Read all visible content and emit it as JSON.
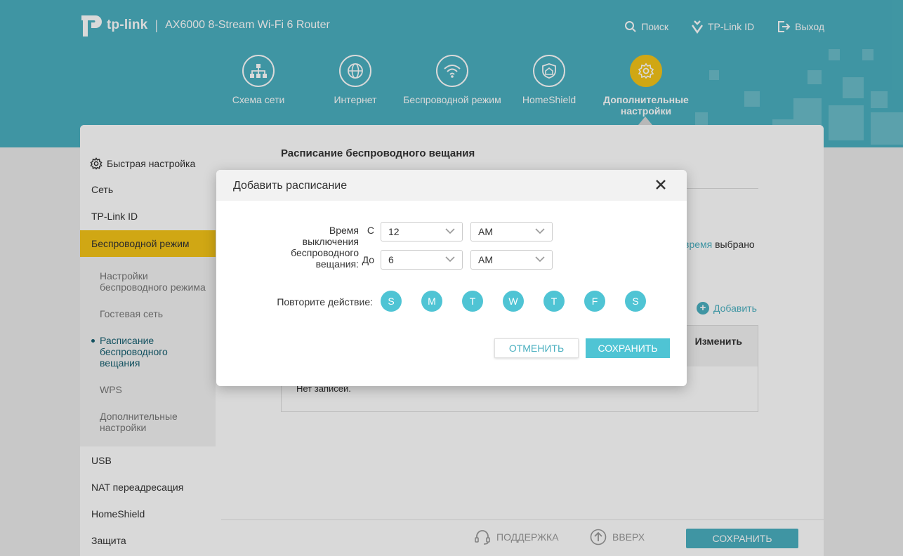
{
  "header": {
    "brand": "tp-link",
    "model": "AX6000 8-Stream Wi-Fi 6 Router",
    "links": [
      {
        "label": "Поиск",
        "icon": "search-icon"
      },
      {
        "label": "TP-Link ID",
        "icon": "tplink-id-icon"
      },
      {
        "label": "Выход",
        "icon": "logout-icon"
      }
    ]
  },
  "nav": {
    "items": [
      {
        "label": "Схема сети",
        "icon": "network-map-icon"
      },
      {
        "label": "Интернет",
        "icon": "globe-icon"
      },
      {
        "label": "Беспроводной режим",
        "icon": "wifi-icon"
      },
      {
        "label": "HomeShield",
        "icon": "home-shield-icon"
      },
      {
        "label": "Дополнительные настройки",
        "icon": "gear-icon",
        "active": true
      }
    ]
  },
  "sidebar": {
    "quick_setup": "Быстрая настройка",
    "items": [
      "Сеть",
      "TP-Link ID",
      "Беспроводной режим"
    ],
    "sub_items": [
      "Настройки беспроводного режима",
      "Гостевая сеть",
      "Расписание беспроводного вещания",
      "WPS",
      "Дополнительные настройки"
    ],
    "items_after": [
      "USB",
      "NAT переадресация",
      "HomeShield",
      "Защита"
    ]
  },
  "content": {
    "title": "Расписание беспроводного вещания",
    "desc_link": "время",
    "desc_text": " выбрано",
    "add_label": "Добавить",
    "column_edit": "Изменить",
    "empty_text": "Нет записей."
  },
  "footer": {
    "support": "ПОДДЕРЖКА",
    "up": "ВВЕРХ",
    "save": "СОХРАНИТЬ"
  },
  "modal": {
    "title": "Добавить расписание",
    "off_time_label": "Время выключения беспроводного вещания:",
    "from_label": "С",
    "to_label": "До",
    "from_hour": "12",
    "from_ampm": "AM",
    "to_hour": "6",
    "to_ampm": "AM",
    "repeat_label": "Повторите действие:",
    "days": [
      "S",
      "M",
      "T",
      "W",
      "T",
      "F",
      "S"
    ],
    "cancel": "ОТМЕНИТЬ",
    "save": "СОХРАНИТЬ"
  },
  "colors": {
    "teal": "#4bb0c0",
    "accent_yellow": "#f5c518",
    "day_circle": "#4fc4d4"
  }
}
